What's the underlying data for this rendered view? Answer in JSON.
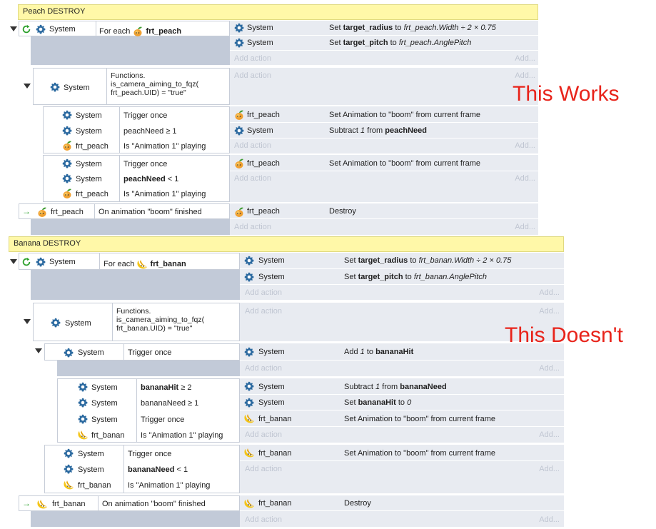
{
  "peach": {
    "group_title": "Peach DESTROY",
    "e1": {
      "obj": "System",
      "cond_prefix": "For each",
      "cond_obj": "frt_peach",
      "actions": [
        {
          "obj": "System",
          "t1": "Set ",
          "b1": "target_radius",
          "t2": " to ",
          "i1": "frt_peach.Width ÷ 2 × 0.75"
        },
        {
          "obj": "System",
          "t1": "Set ",
          "b1": "target_pitch",
          "t2": " to ",
          "i1": "frt_peach.AnglePitch"
        }
      ]
    },
    "e2": {
      "obj": "System",
      "cond": "Functions.\nis_camera_aiming_to_fqz(\nfrt_peach.UID) = \"true\""
    },
    "e3": {
      "conds": [
        {
          "obj": "System",
          "text": "Trigger once"
        },
        {
          "obj": "System",
          "text": "peachNeed ≥ 1"
        },
        {
          "obj": "frt_peach",
          "text": "Is \"Animation 1\" playing"
        }
      ],
      "actions": [
        {
          "obj": "frt_peach",
          "text": "Set Animation to \"boom\" from current frame"
        },
        {
          "obj": "System",
          "t1": "Subtract ",
          "i1": "1",
          "t2": " from ",
          "b1": "peachNeed"
        }
      ]
    },
    "e4": {
      "conds": [
        {
          "obj": "System",
          "text": "Trigger once"
        },
        {
          "obj": "System",
          "b": "peachNeed",
          "text": " < 1"
        },
        {
          "obj": "frt_peach",
          "text": "Is \"Animation 1\" playing"
        }
      ],
      "actions": [
        {
          "obj": "frt_peach",
          "text": "Set Animation to \"boom\" from current frame"
        }
      ]
    },
    "e5": {
      "obj": "frt_peach",
      "cond": "On animation \"boom\" finished",
      "actions": [
        {
          "obj": "frt_peach",
          "text": "Destroy"
        }
      ]
    }
  },
  "banana": {
    "group_title": "Banana DESTROY",
    "e1": {
      "obj": "System",
      "cond_prefix": "For each",
      "cond_obj": "frt_banan",
      "actions": [
        {
          "obj": "System",
          "t1": "Set ",
          "b1": "target_radius",
          "t2": " to ",
          "i1": "frt_banan.Width ÷ 2 × 0.75"
        },
        {
          "obj": "System",
          "t1": "Set ",
          "b1": "target_pitch",
          "t2": " to ",
          "i1": "frt_banan.AnglePitch"
        }
      ]
    },
    "e2": {
      "obj": "System",
      "cond": "Functions.\nis_camera_aiming_to_fqz(\nfrt_banan.UID) = \"true\""
    },
    "e3": {
      "obj": "System",
      "cond": "Trigger once",
      "actions": [
        {
          "obj": "System",
          "t1": "Add ",
          "i1": "1",
          "t2": " to ",
          "b1": "bananaHit"
        }
      ]
    },
    "e4": {
      "conds": [
        {
          "obj": "System",
          "b": "bananaHit",
          "text": " ≥ 2"
        },
        {
          "obj": "System",
          "text": "bananaNeed ≥ 1"
        },
        {
          "obj": "System",
          "text": "Trigger once"
        },
        {
          "obj": "frt_banan",
          "text": "Is \"Animation 1\" playing"
        }
      ],
      "actions": [
        {
          "obj": "System",
          "t1": "Subtract ",
          "i1": "1",
          "t2": " from ",
          "b1": "bananaNeed"
        },
        {
          "obj": "System",
          "t1": "Set ",
          "b1": "bananaHit",
          "t2": " to ",
          "i1": "0"
        },
        {
          "obj": "frt_banan",
          "text": "Set Animation to \"boom\" from current frame"
        }
      ]
    },
    "e5": {
      "conds": [
        {
          "obj": "System",
          "text": "Trigger once"
        },
        {
          "obj": "System",
          "b": "bananaNeed",
          "text": " < 1"
        },
        {
          "obj": "frt_banan",
          "text": "Is \"Animation 1\" playing"
        }
      ],
      "actions": [
        {
          "obj": "frt_banan",
          "text": "Set Animation to \"boom\" from current frame"
        }
      ]
    },
    "e6": {
      "obj": "frt_banan",
      "cond": "On animation \"boom\" finished",
      "actions": [
        {
          "obj": "frt_banan",
          "text": "Destroy"
        }
      ]
    }
  },
  "common": {
    "add_action": "Add action",
    "add": "Add..."
  },
  "notes": {
    "works": "This Works",
    "doesnt": "This Doesn't"
  },
  "colors": {
    "note": "#e8231a",
    "group_header": "#fff8a8",
    "action_bg": "#e8ebf1",
    "blank_bg": "#c2cad8"
  },
  "icons": {
    "system": "gear-icon",
    "peach": "peach-icon",
    "banana": "banana-icon",
    "loop": "loop-icon",
    "trigger": "trigger-arrow-icon",
    "collapse": "collapse-triangle-icon"
  }
}
